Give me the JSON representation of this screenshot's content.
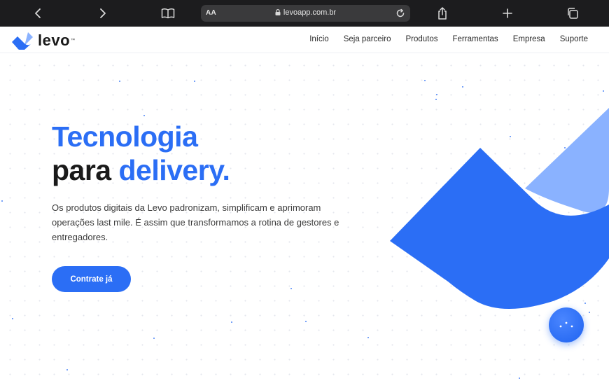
{
  "browser": {
    "text_size_label": "AA",
    "url": "levoapp.com.br",
    "icons": [
      "back-icon",
      "forward-icon",
      "bookmarks-icon",
      "lock-icon",
      "reload-icon",
      "share-icon",
      "new-tab-icon",
      "tabs-icon"
    ]
  },
  "site": {
    "logo_text": "levo",
    "logo_tm": "™",
    "nav": [
      "Início",
      "Seja parceiro",
      "Produtos",
      "Ferramentas",
      "Empresa",
      "Suporte"
    ]
  },
  "hero": {
    "headline_line1": "Tecnologia",
    "headline_line2_dark": "para ",
    "headline_line2_blue": "delivery.",
    "description": "Os produtos digitais da Levo padronizam, simplificam e aprimoram operações last mile. É assim que transformamos a rotina de gestores e entregadores.",
    "cta_label": "Contrate já"
  },
  "colors": {
    "brand_blue": "#2b6ef5",
    "light_blue": "#8ab2ff",
    "text_dark": "#1a1a1a",
    "browser_bar": "#1c1c1e"
  }
}
